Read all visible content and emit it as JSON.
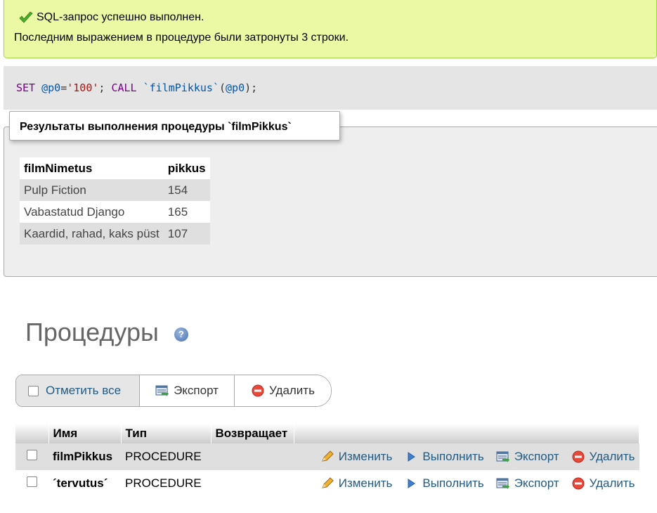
{
  "message": {
    "title": "SQL-запрос успешно выполнен.",
    "detail": "Последним выражением в процедуре были затронуты 3 строки."
  },
  "sql": {
    "kw_set": "SET",
    "var1": "@p0",
    "eq": "=",
    "value": "'100'",
    "semi1": ";",
    "kw_call": "CALL",
    "proc": "`filmPikkus`",
    "open": "(",
    "var2": "@p0",
    "close": ");"
  },
  "results": {
    "legend": "Результаты выполнения процедуры `filmPikkus`",
    "columns": [
      "filmNimetus",
      "pikkus"
    ],
    "rows": [
      [
        "Pulp Fiction",
        "154"
      ],
      [
        "Vabastatud Django",
        "165"
      ],
      [
        "Kaardid, rahad, kaks püst",
        "107"
      ]
    ]
  },
  "procedures": {
    "heading": "Процедуры",
    "help_icon": "help-icon",
    "toolbar": {
      "check_all": "Отметить все",
      "export": "Экспорт",
      "delete": "Удалить"
    },
    "columns": [
      "Имя",
      "Тип",
      "Возвращает"
    ],
    "rows": [
      {
        "name": "filmPikkus",
        "type": "PROCEDURE",
        "returns": "",
        "edit": "Изменить",
        "execute": "Выполнить",
        "export": "Экспорт",
        "delete": "Удалить"
      },
      {
        "name": "´tervutus´",
        "type": "PROCEDURE",
        "returns": "",
        "edit": "Изменить",
        "execute": "Выполнить",
        "export": "Экспорт",
        "delete": "Удалить"
      }
    ]
  },
  "colors": {
    "success_bg": "#ebf8a4",
    "success_border": "#a2d246",
    "link": "#235a81",
    "keyword": "#770088",
    "string": "#aa1111"
  }
}
